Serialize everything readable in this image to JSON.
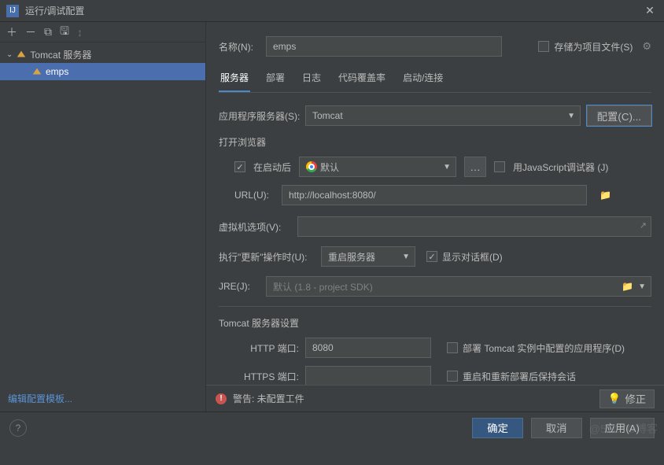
{
  "window": {
    "title": "运行/调试配置"
  },
  "sidebar": {
    "toolbar_tips": [
      "add",
      "remove",
      "copy",
      "save",
      "sort"
    ],
    "root": {
      "label": "Tomcat 服务器"
    },
    "items": [
      {
        "label": "emps"
      }
    ],
    "edit_templates": "编辑配置模板..."
  },
  "header": {
    "name_label": "名称(N):",
    "name_value": "emps",
    "store_as_file": "存储为项目文件(S)"
  },
  "tabs": [
    "服务器",
    "部署",
    "日志",
    "代码覆盖率",
    "启动/连接"
  ],
  "server": {
    "app_server_label": "应用程序服务器(S):",
    "app_server_value": "Tomcat",
    "configure_btn": "配置(C)...",
    "open_browser_title": "打开浏览器",
    "after_launch": "在启动后",
    "browser_default": "默认",
    "js_debugger": "用JavaScript调试器 (J)",
    "url_label": "URL(U):",
    "url_value": "http://localhost:8080/",
    "vm_label": "虚拟机选项(V):",
    "vm_value": "",
    "on_update_label": "执行\"更新\"操作时(U):",
    "on_update_value": "重启服务器",
    "show_dialog": "显示对话框(D)",
    "jre_label": "JRE(J):",
    "jre_placeholder": "默认 (1.8 - project SDK)",
    "tomcat_settings_title": "Tomcat 服务器设置",
    "http_port_label": "HTTP 端口:",
    "http_port_value": "8080",
    "deploy_in_instance": "部署 Tomcat 实例中配置的应用程序(D)",
    "https_port_label": "HTTPS 端口:",
    "https_port_value": "",
    "preserve_sessions": "重启和重新部署后保持会话"
  },
  "warning": {
    "text": "警告: 未配置工件",
    "fix": "修正"
  },
  "footer": {
    "ok": "确定",
    "cancel": "取消",
    "apply": "应用(A)"
  },
  "watermark": "@51CTO博客"
}
